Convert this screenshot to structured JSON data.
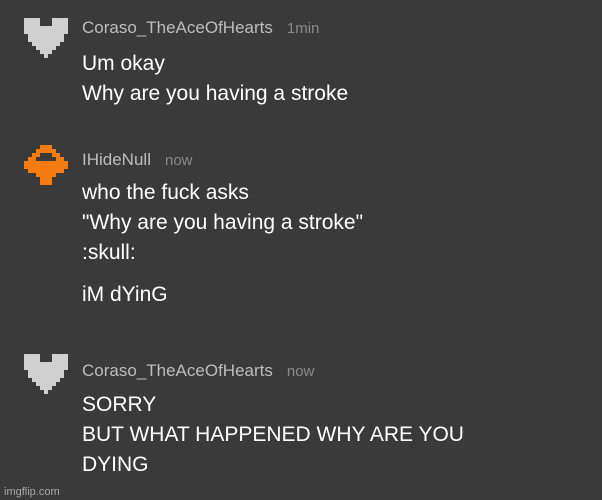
{
  "messages": [
    {
      "username": "Coraso_TheAceOfHearts",
      "timestamp": "1min",
      "avatar_icon": "pixel-heart-icon",
      "avatar_color": "#d0d0d0",
      "lines": [
        "Um okay",
        "Why are you having a stroke"
      ]
    },
    {
      "username": "IHideNull",
      "timestamp": "now",
      "avatar_icon": "pixel-diamond-icon",
      "avatar_color": "#f57c10",
      "lines": [
        "who the fuck asks",
        "\"Why are you having a stroke\"",
        ":skull:"
      ],
      "extra_line": "iM dYinG"
    },
    {
      "username": "Coraso_TheAceOfHearts",
      "timestamp": "now",
      "avatar_icon": "pixel-heart-icon",
      "avatar_color": "#d0d0d0",
      "lines": [
        "SORRY",
        "BUT WHAT HAPPENED WHY ARE YOU",
        "DYING"
      ]
    }
  ],
  "watermark": "imgflip.com",
  "colors": {
    "background": "#3a3a3a",
    "username": "#bdbdbd",
    "timestamp": "#8a8a8a",
    "text": "#ffffff"
  }
}
